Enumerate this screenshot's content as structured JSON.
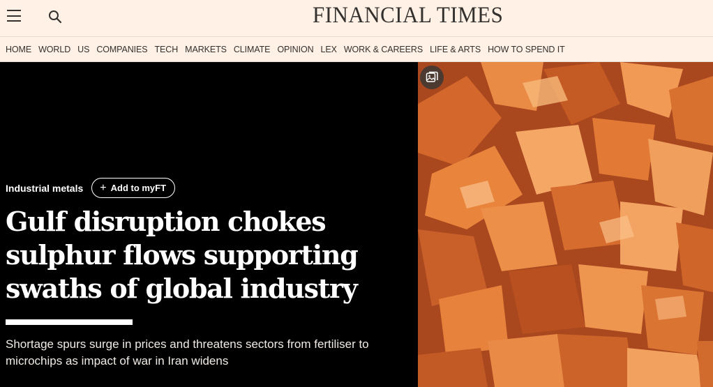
{
  "header": {
    "masthead": "FINANCIAL TIMES",
    "icons": [
      "menu-icon",
      "search-icon"
    ]
  },
  "nav": {
    "items": [
      "HOME",
      "WORLD",
      "US",
      "COMPANIES",
      "TECH",
      "MARKETS",
      "CLIMATE",
      "OPINION",
      "LEX",
      "WORK & CAREERS",
      "LIFE & ARTS",
      "HOW TO SPEND IT"
    ]
  },
  "hero": {
    "topic": "Industrial metals",
    "myft_plus": "+",
    "myft_label": "Add to myFT",
    "headline": "Gulf disruption chokes sulphur flows supporting swaths of global industry",
    "standfirst": "Shortage spurs surge in prices and threatens sectors from fertiliser to microchips as impact of war in Iran widens",
    "image_icon": "gallery-icon"
  },
  "colors": {
    "page_bg": "#fff1e5",
    "hero_bg": "#000000",
    "text_dark": "#33302e",
    "sulphur_orange": "#e8843c"
  }
}
